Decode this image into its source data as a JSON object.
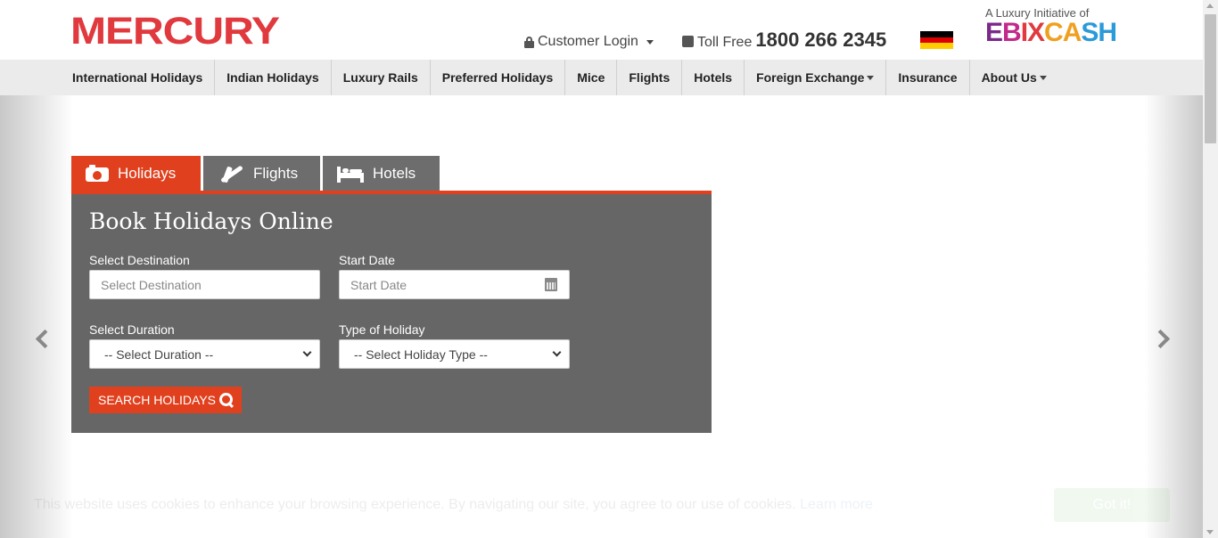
{
  "header": {
    "logo": "MERCURY",
    "customer_login": "Customer Login",
    "toll_free_label": "Toll Free",
    "toll_free_number": "1800 266 2345",
    "ebix_tagline": "A Luxury Initiative of",
    "ebix_parts": [
      "E",
      "B",
      "IX",
      "CA",
      "SH"
    ],
    "flag_colors": [
      "#000000",
      "#dd0000",
      "#ffce00"
    ]
  },
  "nav": {
    "items": [
      {
        "label": "International Holidays"
      },
      {
        "label": "Indian Holidays"
      },
      {
        "label": "Luxury Rails"
      },
      {
        "label": "Preferred Holidays"
      },
      {
        "label": "Mice"
      },
      {
        "label": "Flights"
      },
      {
        "label": "Hotels"
      },
      {
        "label": "Foreign Exchange"
      },
      {
        "label": "Insurance"
      },
      {
        "label": "About Us"
      }
    ]
  },
  "tabs": {
    "holidays": "Holidays",
    "flights": "Flights",
    "hotels": "Hotels",
    "active": "holidays"
  },
  "booking": {
    "title": "Book Holidays Online",
    "destination_label": "Select Destination",
    "destination_placeholder": "Select Destination",
    "start_date_label": "Start Date",
    "start_date_placeholder": "Start Date",
    "duration_label": "Select Duration",
    "duration_value": "-- Select Duration --",
    "holiday_type_label": "Type of Holiday",
    "holiday_type_value": "-- Select Holiday Type --",
    "search_button": "SEARCH HOLIDAYS"
  },
  "cookie": {
    "text": "This website uses cookies to enhance your browsing experience. By navigating our site, you agree to our use of cookies.",
    "link": "Learn more",
    "button": "Got it!"
  },
  "colors": {
    "brand_red": "#e0393e",
    "tab_active": "#e0401e",
    "panel_bg": "#666666"
  }
}
